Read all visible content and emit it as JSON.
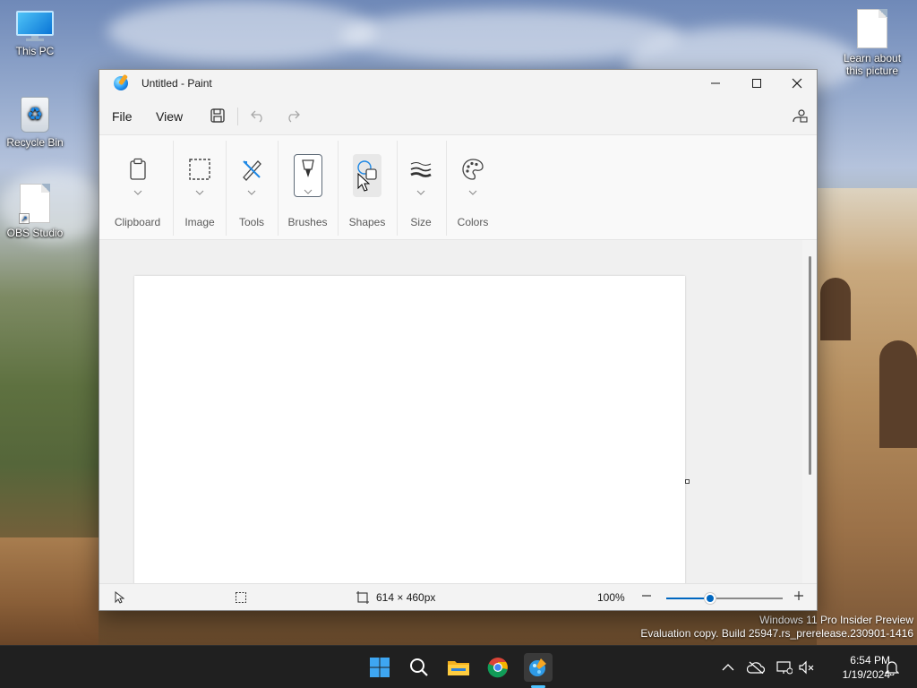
{
  "desktop": {
    "icons": [
      {
        "label": "This PC",
        "icon": "this-pc-icon"
      },
      {
        "label": "Recycle Bin",
        "icon": "recycle-bin-icon"
      },
      {
        "label": "OBS Studio",
        "icon": "obs-studio-shortcut-icon"
      },
      {
        "label": "Learn about this picture",
        "icon": "document-icon"
      }
    ],
    "watermark": {
      "line1": "Windows 11 Pro Insider Preview",
      "line2": "Evaluation copy. Build 25947.rs_prerelease.230901-1416"
    }
  },
  "window": {
    "title": "Untitled - Paint",
    "menu": {
      "file": "File",
      "view": "View"
    },
    "ribbon": {
      "clipboard": "Clipboard",
      "image": "Image",
      "tools": "Tools",
      "brushes": "Brushes",
      "shapes": "Shapes",
      "size": "Size",
      "colors": "Colors"
    },
    "status": {
      "canvas_size": "614 × 460px",
      "zoom": "100%",
      "zoom_fraction": 0.38
    },
    "accent_color": "#0067c0"
  },
  "taskbar": {
    "apps": [
      "start-icon",
      "search-icon",
      "file-explorer-icon",
      "chrome-icon",
      "paint-icon"
    ],
    "time": "6:54 PM",
    "date": "1/19/2024"
  }
}
